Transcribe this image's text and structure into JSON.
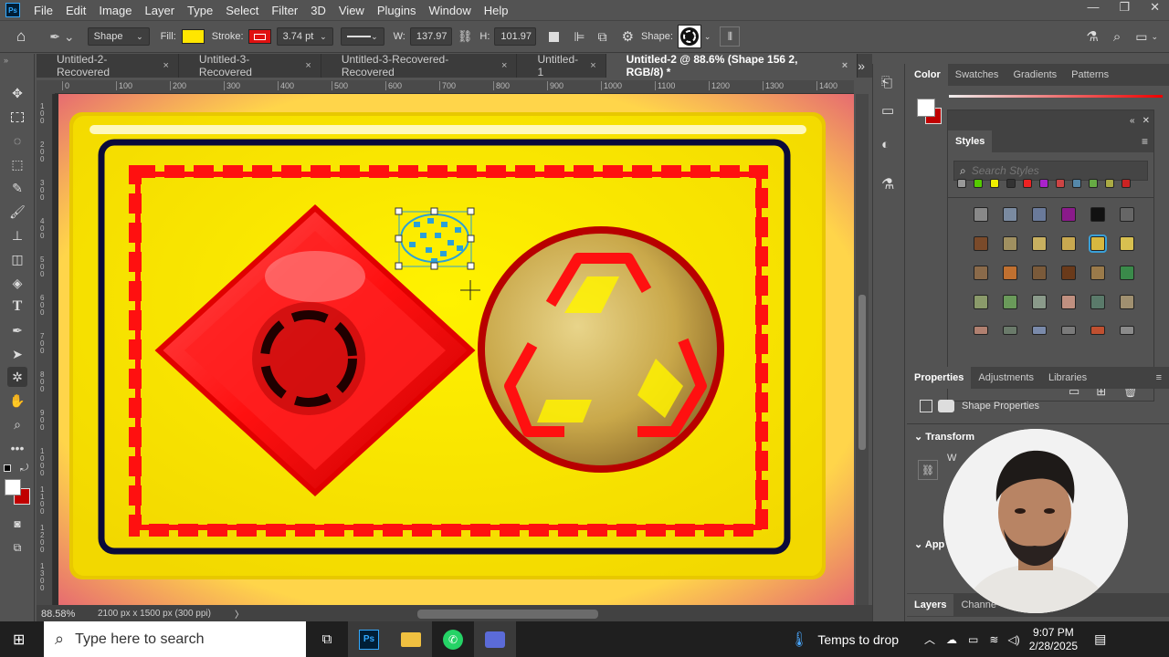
{
  "menubar": {
    "app_logo": "Ps",
    "items": [
      "File",
      "Edit",
      "Image",
      "Layer",
      "Type",
      "Select",
      "Filter",
      "3D",
      "View",
      "Plugins",
      "Window",
      "Help"
    ]
  },
  "optionsbar": {
    "mode": "Shape",
    "fill_label": "Fill:",
    "fill_color": "#ffe600",
    "stroke_label": "Stroke:",
    "stroke_color": "#e01010",
    "stroke_width": "3.74 pt",
    "w_label": "W:",
    "w_value": "137.97",
    "h_label": "H:",
    "h_value": "101.97",
    "shape_label": "Shape:"
  },
  "tabs": [
    {
      "label": "Untitled-2-Recovered",
      "close": "×"
    },
    {
      "label": "Untitled-3-Recovered",
      "close": "×"
    },
    {
      "label": "Untitled-3-Recovered-Recovered",
      "close": "×"
    },
    {
      "label": "Untitled-1",
      "close": "×"
    },
    {
      "label": "Untitled-2 @ 88.6% (Shape 156 2, RGB/8) *",
      "close": "×"
    }
  ],
  "tabs_overflow": "»",
  "ruler": {
    "h_ticks": [
      "0",
      "100",
      "200",
      "300",
      "400",
      "500",
      "600",
      "700",
      "800",
      "900",
      "1000",
      "1100",
      "1200",
      "1300",
      "1400"
    ],
    "v_ticks": [
      "1\n0\n0",
      "2\n0\n0",
      "3\n0\n0",
      "4\n0\n0",
      "5\n0\n0",
      "6\n0\n0",
      "7\n0\n0",
      "8\n0\n0",
      "9\n0\n0",
      "1\n0\n0\n0",
      "1\n1\n0\n0",
      "1\n2\n0\n0",
      "1\n3\n0\n0"
    ]
  },
  "status": {
    "zoom": "88.58%",
    "doc_info": "2100 px x 1500 px (300 ppi)",
    "arrow": "〉"
  },
  "color_panel": {
    "tabs": [
      "Color",
      "Swatches",
      "Gradients",
      "Patterns"
    ],
    "active": "Color",
    "fg": "#ffffff",
    "bg": "#c00000"
  },
  "styles_panel": {
    "title": "Styles",
    "search_placeholder": "Search Styles"
  },
  "properties_panel": {
    "tabs": [
      "Properties",
      "Adjustments",
      "Libraries"
    ],
    "active": "Properties",
    "shape_properties": "Shape Properties",
    "transform": "Transform",
    "w_label": "W",
    "appearance": "App"
  },
  "layers_panel": {
    "tabs": [
      "Layers",
      "Channe"
    ]
  },
  "taskbar": {
    "search": "Type here to search",
    "weather": "Temps to drop",
    "time": "9:07 PM",
    "date": "2/28/2025"
  },
  "colors": {
    "canvas_yellow": "#ffea00",
    "stamp_red": "#ff1010",
    "frame_navy": "#0a0a3a",
    "selection_blue": "#2aa0d8"
  }
}
